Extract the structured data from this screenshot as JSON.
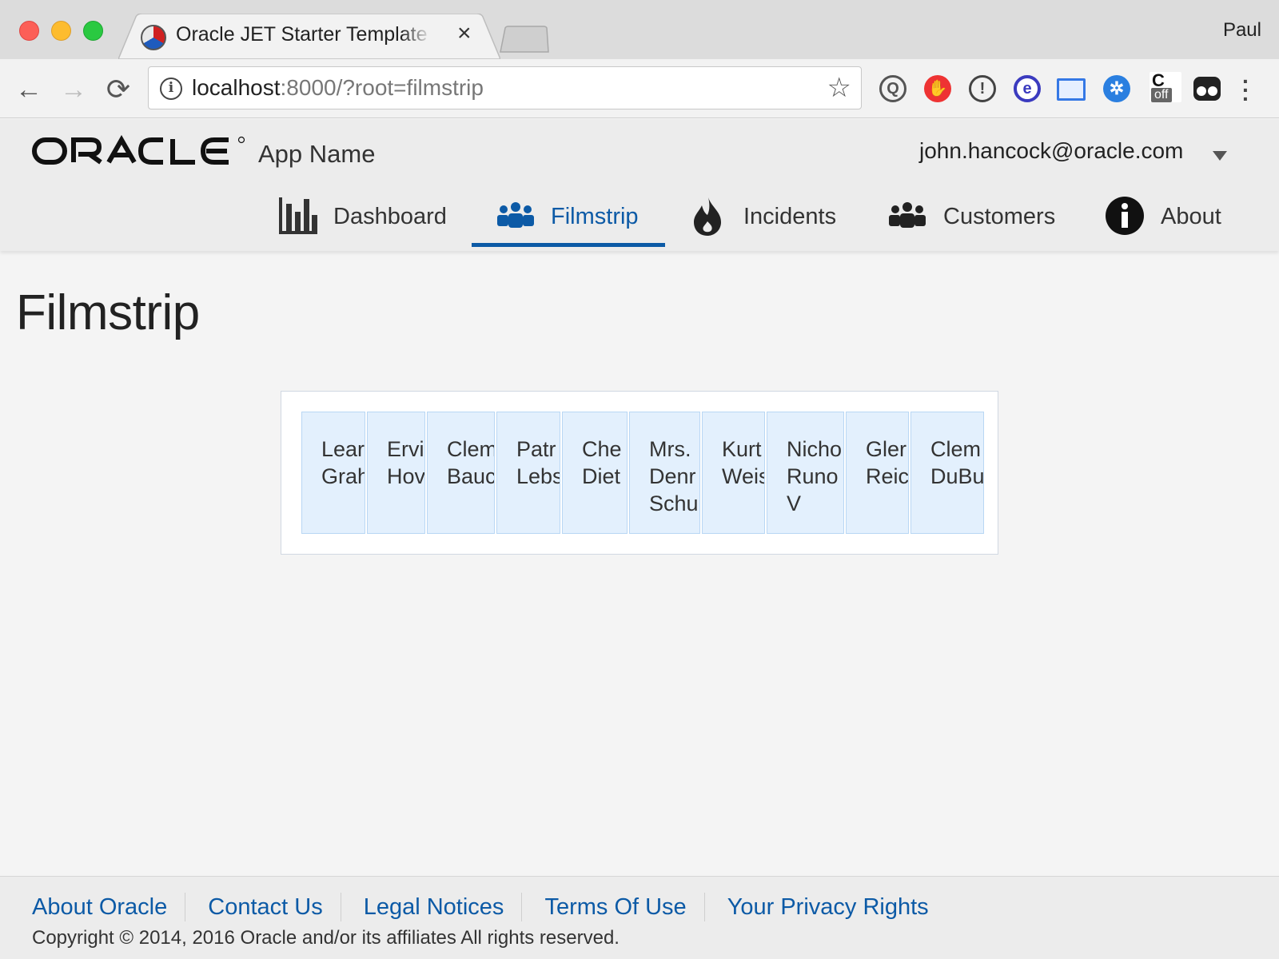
{
  "browser": {
    "tab_title": "Oracle JET Starter Template - Web Nav Bar",
    "tab_close": "×",
    "profile_name": "Paul",
    "url_host": "localhost",
    "url_rest": ":8000/?root=filmstrip",
    "back_glyph": "←",
    "forward_glyph": "→",
    "reload_glyph": "⟳",
    "star_glyph": "☆",
    "info_glyph": "i",
    "menu_glyph": "⋮",
    "extensions": [
      "sync-icon",
      "hand-stop-icon",
      "password-icon",
      "edge-icon",
      "screenshot-icon",
      "network-icon",
      "css-off-icon",
      "glasses-icon"
    ],
    "ext_off_label": "off"
  },
  "header": {
    "app_name": "App Name",
    "user_email": "john.hancock@oracle.com"
  },
  "nav": {
    "items": [
      {
        "label": "Dashboard",
        "icon": "bar-chart-icon"
      },
      {
        "label": "Filmstrip",
        "icon": "people-icon",
        "selected": true
      },
      {
        "label": "Incidents",
        "icon": "fire-icon"
      },
      {
        "label": "Customers",
        "icon": "people-icon"
      },
      {
        "label": "About",
        "icon": "info-icon"
      }
    ],
    "accent": "#0c5aa6"
  },
  "page": {
    "title": "Filmstrip"
  },
  "filmstrip": {
    "items": [
      {
        "line1": "Lear",
        "line2": "Grah"
      },
      {
        "line1": "Ervi",
        "line2": "Hov"
      },
      {
        "line1": "Clem",
        "line2": "Bauc"
      },
      {
        "line1": "Patr",
        "line2": "Lebs"
      },
      {
        "line1": "Che",
        "line2": "Diet"
      },
      {
        "line1": "Mrs.",
        "line2": "Denr",
        "line3": "Schu"
      },
      {
        "line1": "Kurt",
        "line2": "Weis"
      },
      {
        "line1": "Nicho",
        "line2": "Runo",
        "line3": "V"
      },
      {
        "line1": "Gler",
        "line2": "Reic"
      },
      {
        "line1": "Clem",
        "line2": "DuBu"
      }
    ]
  },
  "footer": {
    "links": [
      "About Oracle",
      "Contact Us",
      "Legal Notices",
      "Terms Of Use",
      "Your Privacy Rights"
    ],
    "copyright": "Copyright © 2014, 2016 Oracle and/or its affiliates All rights reserved."
  }
}
